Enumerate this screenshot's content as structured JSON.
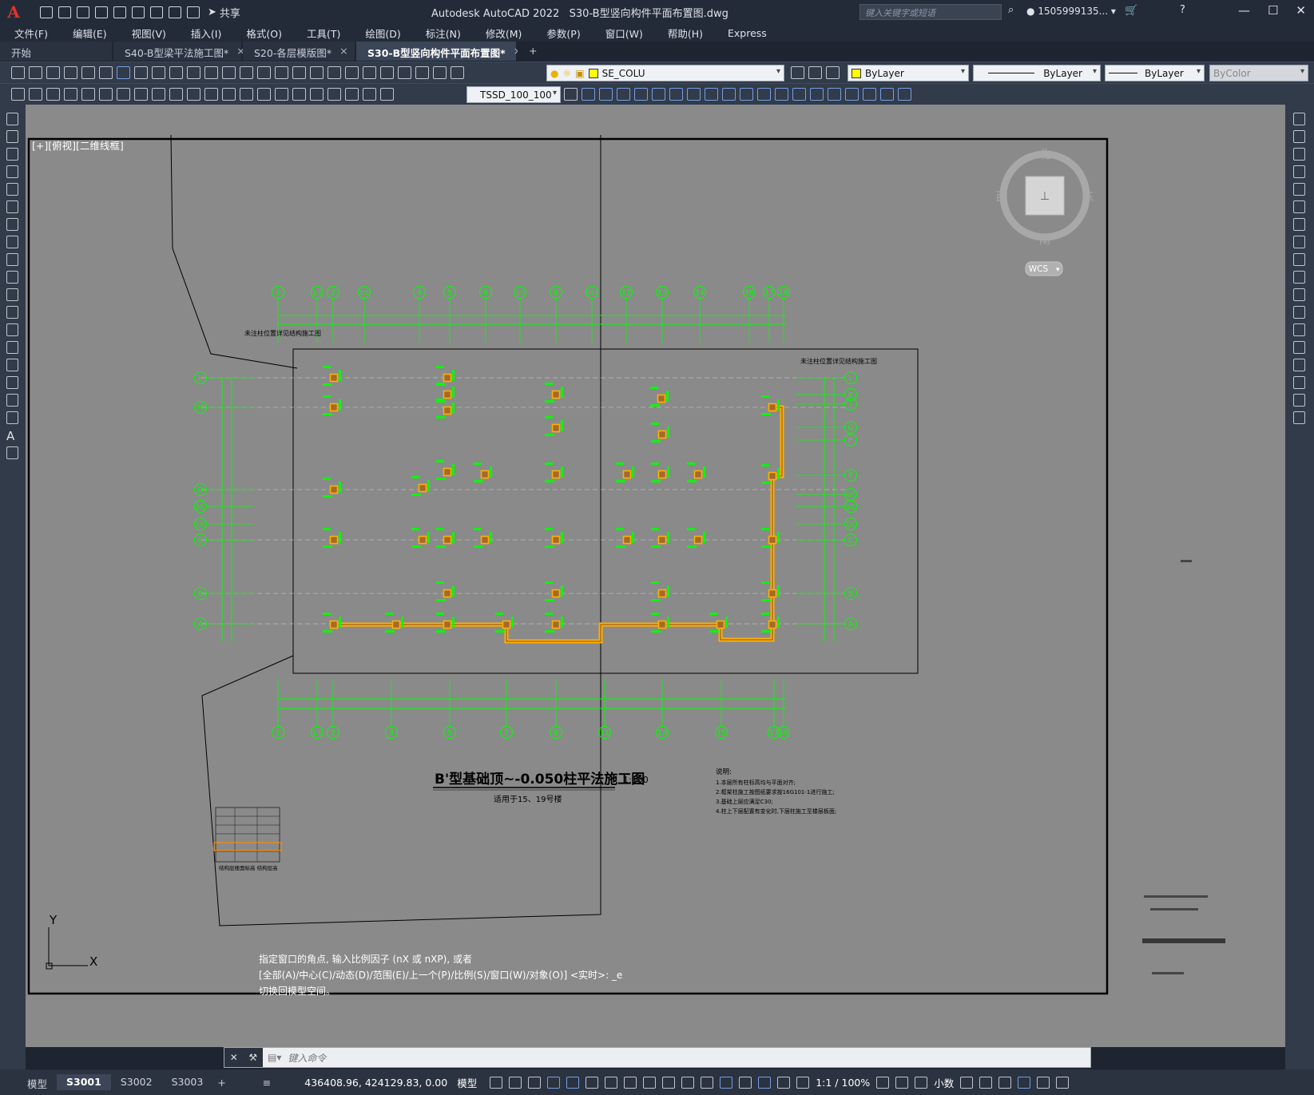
{
  "app": {
    "title": "Autodesk AutoCAD 2022",
    "file": "S30-B型竖向构件平面布置图.dwg",
    "share": "共享",
    "search_placeholder": "键入关键字或短语",
    "user": "1505999135...",
    "help": "?"
  },
  "menu": [
    "文件(F)",
    "编辑(E)",
    "视图(V)",
    "插入(I)",
    "格式(O)",
    "工具(T)",
    "绘图(D)",
    "标注(N)",
    "修改(M)",
    "参数(P)",
    "窗口(W)",
    "帮助(H)",
    "Express"
  ],
  "tabs": [
    {
      "label": "开始"
    },
    {
      "label": "S40-B型梁平法施工图*"
    },
    {
      "label": "S20-各层模版图*"
    },
    {
      "label": "S30-B型竖向构件平面布置图*",
      "active": true
    }
  ],
  "toolbar": {
    "layer": "SE_COLU",
    "color": "ByLayer",
    "linetype": "ByLayer",
    "lineweight": "ByLayer",
    "plotstyle": "ByColor",
    "dimstyle": "TSSD_100_100"
  },
  "viewport": {
    "label": "[+][俯视][二维线框]",
    "compass": {
      "n": "北",
      "s": "南",
      "e": "东",
      "w": "西",
      "ucs": "WCS"
    },
    "ucs_x": "X",
    "ucs_y": "Y"
  },
  "drawing": {
    "grid_top": [
      "1",
      "1/1",
      "2",
      "1/2",
      "4",
      "5",
      "6",
      "1/7",
      "9",
      "1/10",
      "12",
      "13",
      "14",
      "16",
      "17",
      "18"
    ],
    "grid_bottom": [
      "1",
      "1/1",
      "2",
      "3",
      "5",
      "7",
      "9",
      "11",
      "13",
      "15",
      "17",
      "18"
    ],
    "grid_left": [
      "L",
      "H",
      "D",
      "3/C",
      "1/C",
      "C",
      "B",
      "A"
    ],
    "grid_right": [
      "L",
      "K",
      "J",
      "G",
      "F",
      "E",
      "4/C",
      "3/C",
      "1/C",
      "C",
      "B",
      "A"
    ],
    "title": "B'型基础顶~-0.050柱平法施工图",
    "scale": "1:100",
    "subtitle": "适用于15、19号楼",
    "notes_title": "说明:",
    "notes": [
      "1.本层所有柱标高均与平面对齐;",
      "2.框架柱施工按图纸要求按16G101-1进行施工;",
      "3.基础上层应满足C30;",
      "4.柱上下层配置有变化时,下层柱施工至楼层板面;"
    ],
    "left_note": "未注柱位置详见结构施工图",
    "right_note": "未注柱位置详见结构施工图",
    "table_caption": "结构层楼面标高 结构层高"
  },
  "command": {
    "history": [
      "指定窗口的角点, 输入比例因子 (nX 或 nXP), 或者",
      "[全部(A)/中心(C)/动态(D)/范围(E)/上一个(P)/比例(S)/窗口(W)/对象(O)] <实时>: _e",
      "切换回模型空间。"
    ],
    "placeholder": "键入命令"
  },
  "status": {
    "layouts": [
      "模型",
      "S3001",
      "S3002",
      "S3003"
    ],
    "active_layout": "S3001",
    "coords": "436408.96, 424129.83, 0.00",
    "mode": "模型",
    "scale": "1:1 / 100%",
    "units": "小数"
  }
}
